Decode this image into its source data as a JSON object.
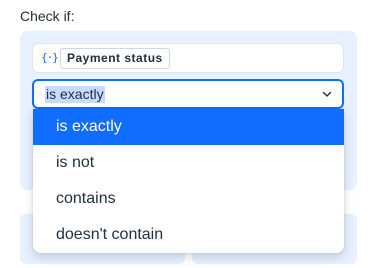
{
  "condition": {
    "label": "Check if:",
    "variable": {
      "icon": "{·}",
      "name": "Payment status"
    },
    "operator": {
      "selected": "is exactly",
      "options": [
        "is exactly",
        "is not",
        "contains",
        "doesn't contain"
      ]
    }
  },
  "colors": {
    "accent": "#116dff",
    "panel_bg": "#e7f0ff",
    "text": "#20303c"
  }
}
